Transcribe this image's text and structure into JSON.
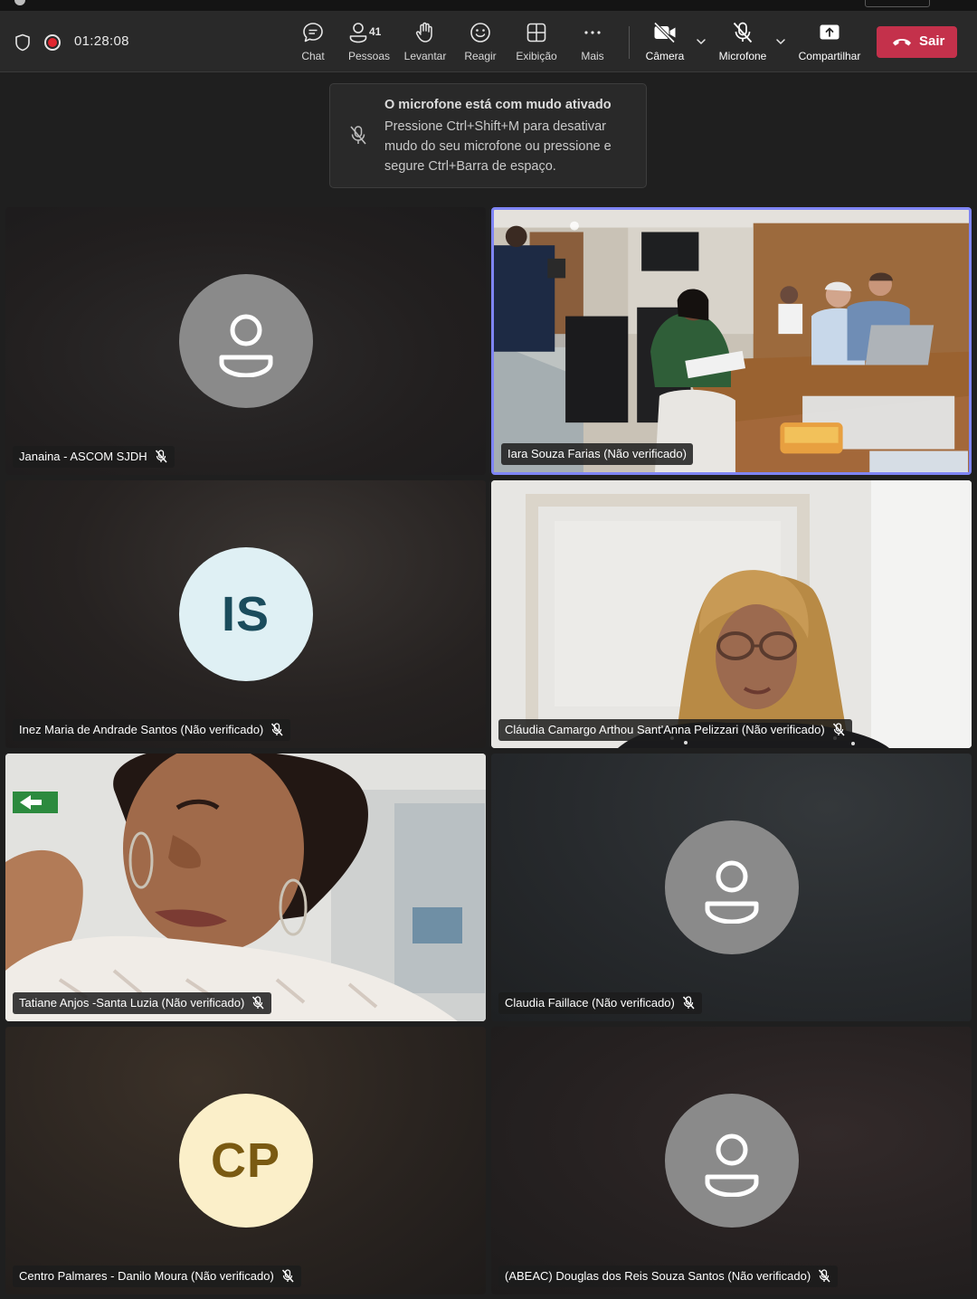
{
  "toolbar": {
    "timer": "01:28:08",
    "chat_label": "Chat",
    "people_label": "Pessoas",
    "people_count": "41",
    "raise_label": "Levantar",
    "react_label": "Reagir",
    "view_label": "Exibição",
    "more_label": "Mais",
    "camera_label": "Câmera",
    "mic_label": "Microfone",
    "share_label": "Compartilhar",
    "leave_label": "Sair",
    "leave_color": "#c4314b",
    "recording_color": "#e0262f"
  },
  "toast": {
    "title": "O microfone está com mudo ativado",
    "body": "Pressione Ctrl+Shift+M para desativar mudo do seu microfone ou pressione e segure Ctrl+Barra de espaço."
  },
  "participants": [
    {
      "name": "Janaina - ASCOM SJDH",
      "avatar": "person-icon",
      "muted": true
    },
    {
      "name": "Iara Souza Farias (Não verificado)",
      "avatar": "video",
      "muted": false,
      "speaking": true
    },
    {
      "name": "Inez Maria de Andrade Santos (Não verificado)",
      "initials": "IS",
      "muted": true
    },
    {
      "name": "Cláudia Camargo Arthou Sant'Anna Pelizzari (Não verificado)",
      "avatar": "video",
      "muted": true
    },
    {
      "name": "Tatiane Anjos -Santa Luzia (Não verificado)",
      "avatar": "video",
      "muted": true
    },
    {
      "name": "Claudia Faillace (Não verificado)",
      "avatar": "person-icon",
      "muted": true
    },
    {
      "name": "Centro Palmares - Danilo Moura (Não verificado)",
      "initials": "CP",
      "muted": true
    },
    {
      "name": "(ABEAC) Douglas dos Reis Souza Santos (Não verificado)",
      "avatar": "person-icon",
      "muted": true
    }
  ],
  "speaking_color": "#7f85f5"
}
